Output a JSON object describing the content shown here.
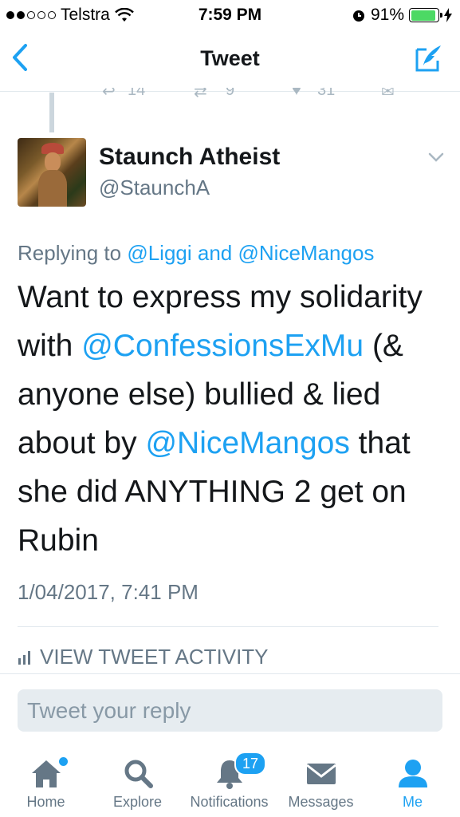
{
  "status_bar": {
    "carrier": "Telstra",
    "time": "7:59 PM",
    "battery": "91%"
  },
  "nav": {
    "title": "Tweet"
  },
  "previous_tweet": {
    "reply_count": "14",
    "retweet_count": "9",
    "like_count": "31"
  },
  "tweet": {
    "author_name": "Staunch Atheist",
    "author_handle": "@StaunchA",
    "replying_prefix": "Replying to",
    "replying_user1": "@Liggi",
    "replying_and": "and",
    "replying_user2": "@NiceMangos",
    "text_part1": "Want to express my solidarity with ",
    "mention1": "@ConfessionsExMu",
    "text_part2": " (& anyone else) bullied & lied about by ",
    "mention2": "@NiceMangos",
    "text_part3": " that she did ANYTHING 2 get on Rubin",
    "timestamp": "1/04/2017, 7:41 PM"
  },
  "activity_label": "VIEW TWEET ACTIVITY",
  "reply": {
    "placeholder": "Tweet your reply"
  },
  "tabs": [
    {
      "label": "Home",
      "icon": "home-icon"
    },
    {
      "label": "Explore",
      "icon": "search-icon"
    },
    {
      "label": "Notifications",
      "icon": "bell-icon",
      "badge": "17"
    },
    {
      "label": "Messages",
      "icon": "envelope-icon"
    },
    {
      "label": "Me",
      "icon": "person-icon",
      "active": true
    }
  ],
  "colors": {
    "accent": "#1da1f2",
    "secondary_text": "#657786",
    "battery": "#4cd964"
  }
}
